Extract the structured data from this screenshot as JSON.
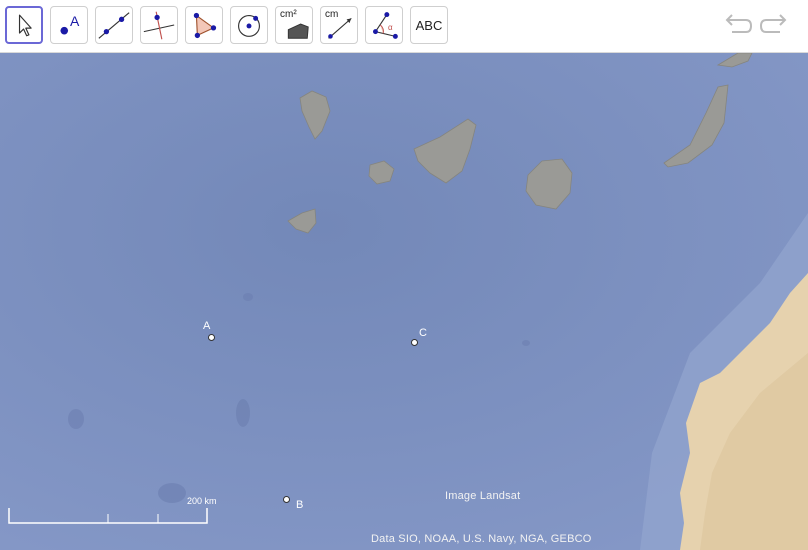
{
  "toolbar": {
    "tools": [
      {
        "name": "move-tool",
        "icon": "cursor-arrow-icon"
      },
      {
        "name": "point-tool",
        "icon": "point-icon",
        "text": "A"
      },
      {
        "name": "line-tool",
        "icon": "line-through-two-points-icon"
      },
      {
        "name": "perpendicular-line-tool",
        "icon": "perpendicular-line-icon"
      },
      {
        "name": "polygon-tool",
        "icon": "polygon-icon"
      },
      {
        "name": "circle-tool",
        "icon": "circle-center-point-icon"
      },
      {
        "name": "area-tool",
        "icon": "area-icon",
        "text": "cm²"
      },
      {
        "name": "distance-tool",
        "icon": "distance-icon",
        "text": "cm"
      },
      {
        "name": "angle-tool",
        "icon": "angle-icon",
        "text": "α"
      },
      {
        "name": "text-tool",
        "icon": "text-icon",
        "text": "ABC"
      }
    ],
    "undo_icon": "undo-icon",
    "redo_icon": "redo-icon",
    "accent": "#6b68d6"
  },
  "map": {
    "points": [
      {
        "label": "A"
      },
      {
        "label": "B"
      },
      {
        "label": "C"
      }
    ],
    "scale_label": "200 km",
    "attribution_image": "Image Landsat",
    "attribution_data": "Data SIO, NOAA, U.S. Navy, NGA, GEBCO",
    "ocean_color": "#7b8fc0",
    "land_color": "#e6d2ae",
    "island_color": "#9a9a96"
  }
}
